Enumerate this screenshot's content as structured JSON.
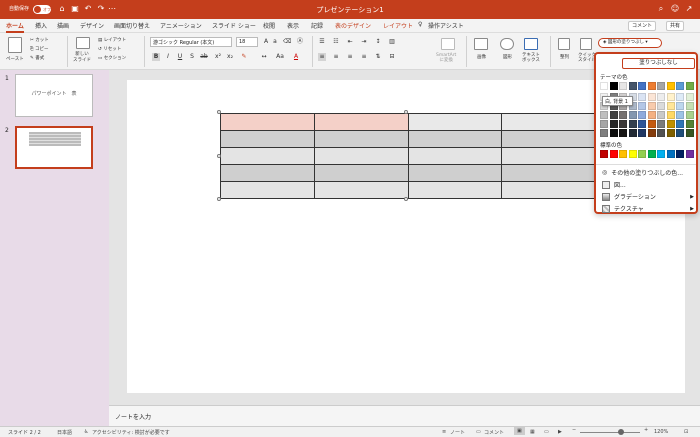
{
  "titlebar": {
    "autosave": "自動保存",
    "toggle": "オフ",
    "doc_title": "プレゼンテーション1"
  },
  "tabs": [
    "ホーム",
    "挿入",
    "描画",
    "デザイン",
    "画面切り替え",
    "アニメーション",
    "スライド ショー",
    "校閲",
    "表示",
    "記録",
    "表のデザイン",
    "レイアウト",
    "操作アシスト"
  ],
  "top_buttons": {
    "comment": "コメント",
    "share": "共有"
  },
  "ribbon": {
    "paste": "ペースト",
    "cut": "カット",
    "copy": "コピー",
    "format": "書式",
    "new_slide": "新しい\nスライド",
    "layout": "レイアウト",
    "reset": "リセット",
    "section": "セクション",
    "font": "游ゴシック Regular (本文)",
    "font_size": "18",
    "smartart": "SmartArt\nに変換",
    "picture": "画像",
    "shapes": "図形",
    "textbox": "テキスト\nボックス",
    "arrange": "整列",
    "quick_style": "クイック\nスタイル"
  },
  "fill_button": {
    "label": "図形の塗りつぶし"
  },
  "slides": [
    {
      "num": "1",
      "title": "パワーポイント　表"
    },
    {
      "num": "2",
      "title": ""
    }
  ],
  "notes": "ノートを入力",
  "status": {
    "slide": "スライド 2 / 2",
    "lang": "日本語",
    "accessibility": "アクセシビリティ: 検討が必要です",
    "notes_btn": "ノート",
    "comments_btn": "コメント",
    "zoom": "120%"
  },
  "dropdown": {
    "no_fill": "塗りつぶしなし",
    "theme_colors_label": "テーマの色",
    "standard_colors_label": "標準の色",
    "tooltip": "白, 背景 1",
    "more_colors": "その他の塗りつぶしの色...",
    "picture": "図...",
    "gradient": "グラデーション",
    "texture": "テクスチャ",
    "theme_top": [
      "#ffffff",
      "#000000",
      "#e7e6e6",
      "#44546a",
      "#4472c4",
      "#ed7d31",
      "#a5a5a5",
      "#ffc000",
      "#5b9bd5",
      "#70ad47"
    ],
    "theme_shades": [
      [
        "#f2f2f2",
        "#7f7f7f",
        "#d0cece",
        "#d6dce5",
        "#dae3f3",
        "#fbe5d6",
        "#ededed",
        "#fff2cc",
        "#deebf7",
        "#e2f0d9"
      ],
      [
        "#d9d9d9",
        "#595959",
        "#aeabab",
        "#adb9ca",
        "#b4c7e7",
        "#f8cbad",
        "#dbdbdb",
        "#ffe699",
        "#bdd7ee",
        "#c5e0b4"
      ],
      [
        "#bfbfbf",
        "#404040",
        "#757171",
        "#8497b0",
        "#8faadc",
        "#f4b183",
        "#c9c9c9",
        "#ffd966",
        "#9dc3e6",
        "#a9d18e"
      ],
      [
        "#a6a6a6",
        "#262626",
        "#3b3838",
        "#333f50",
        "#2f5597",
        "#c55a11",
        "#7b7b7b",
        "#bf9000",
        "#2e75b6",
        "#548235"
      ],
      [
        "#7f7f7f",
        "#0d0d0d",
        "#171616",
        "#222a35",
        "#203864",
        "#843c0c",
        "#525252",
        "#7f6000",
        "#1f4e79",
        "#385723"
      ]
    ],
    "standard": [
      "#c00000",
      "#ff0000",
      "#ffc000",
      "#ffff00",
      "#92d050",
      "#00b050",
      "#00b0f0",
      "#0070c0",
      "#002060",
      "#7030a0"
    ]
  },
  "colors": {
    "accent": "#c43e1c",
    "sidebar": "#e8dbe8"
  }
}
